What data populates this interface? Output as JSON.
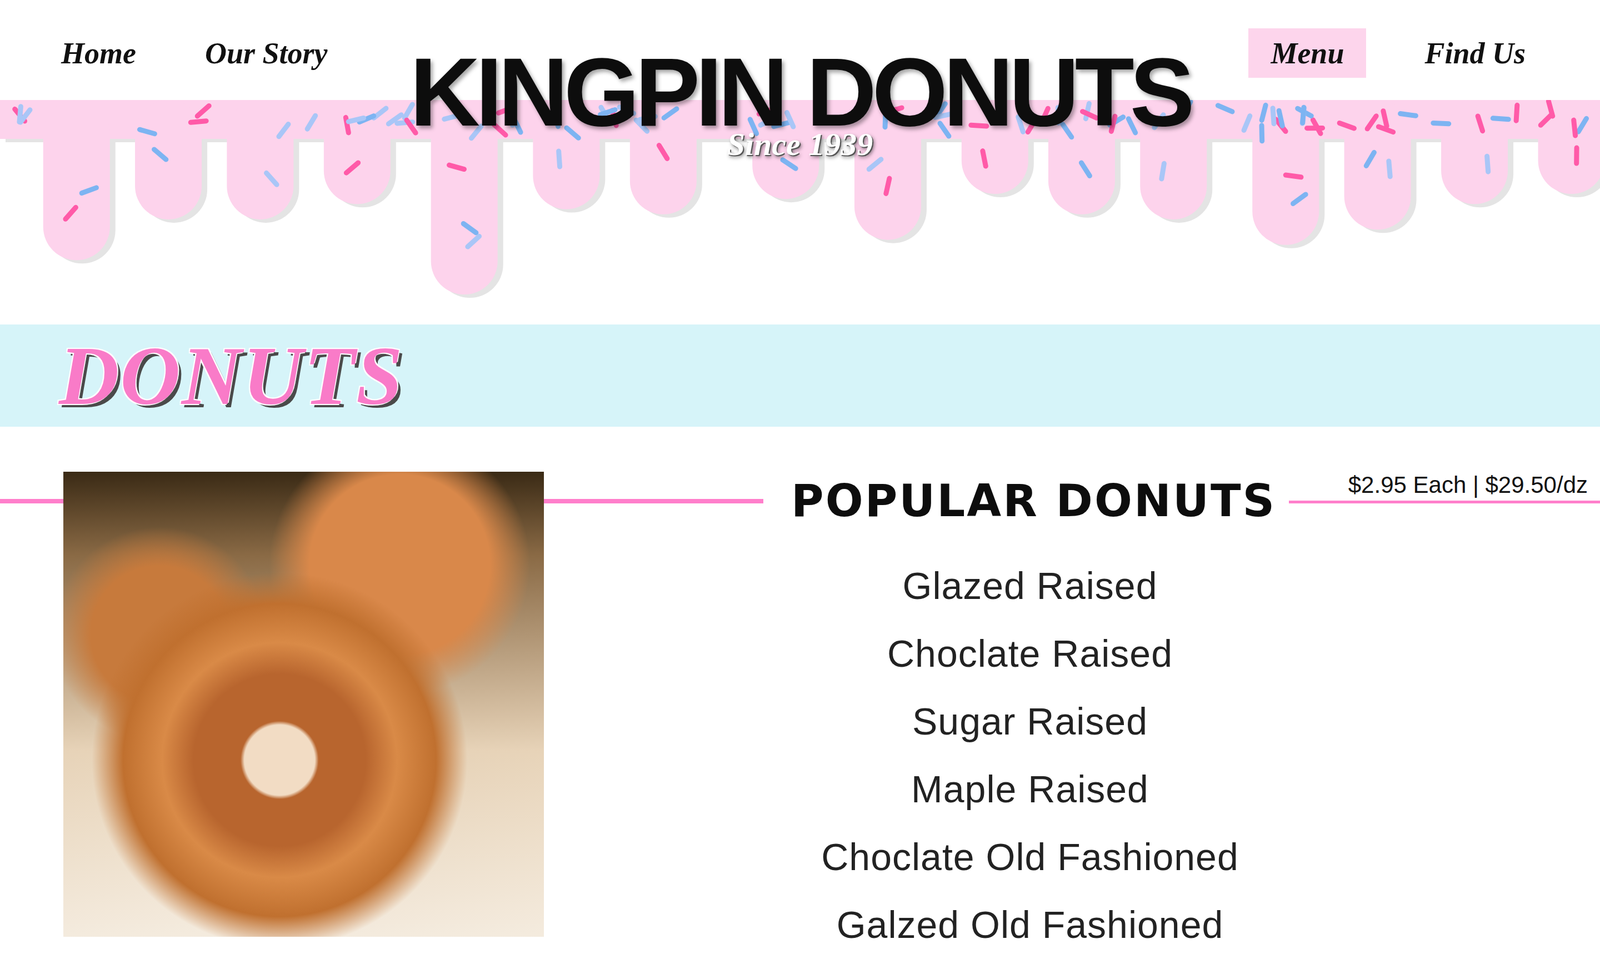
{
  "nav": [
    {
      "label": "Home",
      "selected": false
    },
    {
      "label": "Our Story",
      "selected": false
    },
    {
      "label": "Menu",
      "selected": true
    },
    {
      "label": "Find Us",
      "selected": false
    }
  ],
  "brand": {
    "name": "KINGPIN DONUTS",
    "tagline": "Since 1939"
  },
  "section": {
    "title": "DONUTS"
  },
  "menu": {
    "heading": "POPULAR DONUTS",
    "price": "$2.95 Each | $29.50/dz",
    "items": [
      "Glazed Raised",
      "Choclate Raised",
      "Sugar Raised",
      "Maple Raised",
      "Choclate Old Fashioned",
      "Galzed Old Fashioned"
    ]
  }
}
